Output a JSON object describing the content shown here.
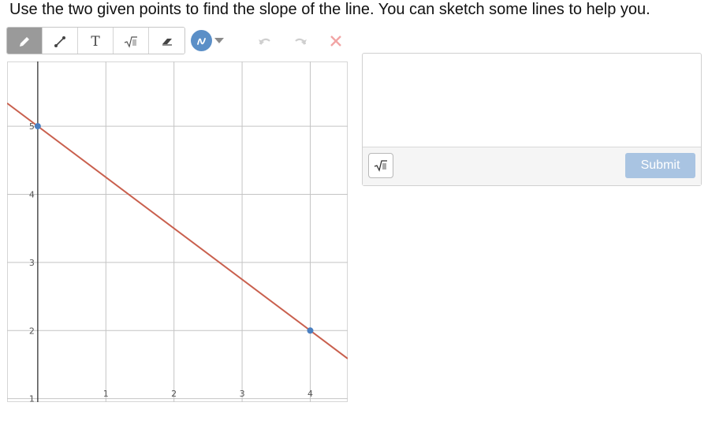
{
  "prompt": "Use the two given points to find the slope of the line. You can sketch some lines to help you.",
  "toolbar": {
    "tools": [
      {
        "name": "pencil-tool",
        "icon": "pencil-icon",
        "active": true
      },
      {
        "name": "line-tool",
        "icon": "line-segment-icon",
        "active": false
      },
      {
        "name": "text-tool",
        "icon": "text-icon",
        "glyph": "T",
        "active": false
      },
      {
        "name": "math-tool",
        "icon": "square-root-icon",
        "glyph": "√",
        "active": false
      },
      {
        "name": "eraser-tool",
        "icon": "eraser-icon",
        "active": false
      }
    ],
    "color_picker": {
      "icon": "ink-color-icon",
      "color": "#5b8fc7"
    },
    "actions": [
      {
        "name": "undo-button",
        "icon": "undo-icon"
      },
      {
        "name": "redo-button",
        "icon": "redo-icon"
      },
      {
        "name": "clear-button",
        "icon": "close-icon",
        "color": "#f2a5a5"
      }
    ]
  },
  "chart_data": {
    "type": "line",
    "xlim": [
      -0.45,
      4.55
    ],
    "ylim": [
      0.95,
      5.95
    ],
    "x_ticks": [
      1,
      2,
      3,
      4
    ],
    "y_ticks": [
      1,
      2,
      3,
      4,
      5
    ],
    "grid": true,
    "line": {
      "points": [
        [
          0,
          5
        ],
        [
          4,
          2
        ]
      ],
      "slope": -0.75,
      "intercept": 5,
      "color": "#c9604e"
    },
    "points": [
      {
        "x": 0,
        "y": 5
      },
      {
        "x": 4,
        "y": 2
      }
    ],
    "point_color": "#4a7fc0"
  },
  "answer": {
    "value": "",
    "math_button_glyph": "√",
    "submit_label": "Submit"
  }
}
